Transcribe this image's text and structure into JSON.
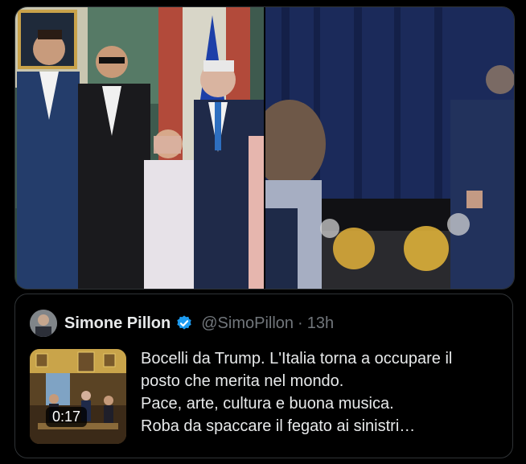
{
  "media": {
    "photos": [
      {
        "name": "group-portrait-photo",
        "icon": "photo"
      },
      {
        "name": "dinner-event-photo",
        "icon": "photo"
      }
    ]
  },
  "quote": {
    "author_name": "Simone Pillon",
    "verified": true,
    "handle": "@SimoPillon",
    "separator": "·",
    "time": "13h",
    "video_duration": "0:17",
    "text_lines": [
      "Bocelli da Trump. L'Italia torna a occupare il",
      "posto che merita nel mondo.",
      "Pace, arte, cultura e buona musica.",
      "Roba da spaccare il fegato ai sinistri…"
    ]
  },
  "colors": {
    "background": "#000000",
    "text_primary": "#e7e9ea",
    "text_secondary": "#71767b",
    "border": "#2f3336",
    "verified_blue": "#1d9bf0"
  }
}
